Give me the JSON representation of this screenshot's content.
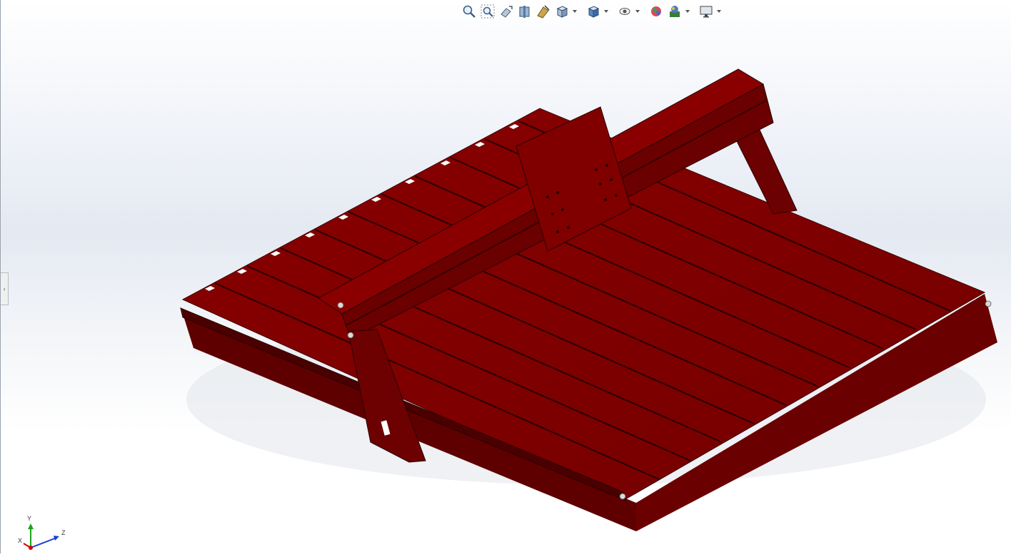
{
  "viewport": {
    "title": "",
    "model_color": "#7a0000"
  },
  "heads_up_toolbar": {
    "buttons": [
      {
        "name": "zoom-to-fit",
        "icon": "zoom-to-fit-icon"
      },
      {
        "name": "zoom-to-area",
        "icon": "zoom-to-area-icon"
      },
      {
        "name": "previous-view",
        "icon": "previous-view-icon"
      },
      {
        "name": "section-view",
        "icon": "section-view-icon"
      },
      {
        "name": "dynamic-annotation-views",
        "icon": "annotation-view-icon"
      },
      {
        "name": "view-orientation",
        "icon": "view-orientation-icon",
        "dropdown": true
      },
      {
        "name": "display-style",
        "icon": "display-style-icon",
        "dropdown": true
      },
      {
        "name": "hide-show-items",
        "icon": "eye-icon",
        "dropdown": true
      },
      {
        "name": "edit-appearance",
        "icon": "edit-appearance-icon"
      },
      {
        "name": "apply-scene",
        "icon": "apply-scene-icon",
        "dropdown": true
      },
      {
        "name": "view-settings",
        "icon": "monitor-icon",
        "dropdown": true
      }
    ]
  },
  "triad": {
    "x_label": "X",
    "y_label": "Y",
    "z_label": "Z",
    "x_color": "#d40000",
    "y_color": "#1aa31a",
    "z_color": "#1a3fd4"
  }
}
